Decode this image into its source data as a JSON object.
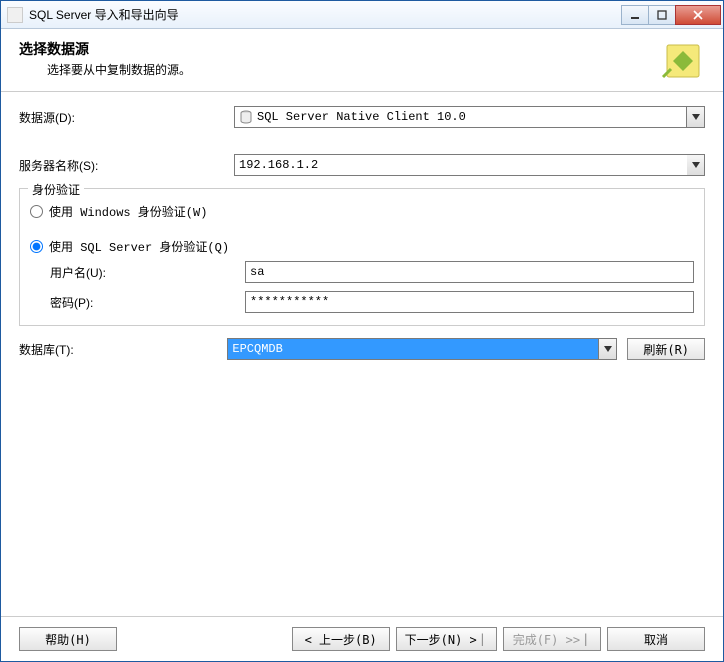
{
  "window": {
    "title": "SQL Server 导入和导出向导"
  },
  "header": {
    "title": "选择数据源",
    "description": "选择要从中复制数据的源。"
  },
  "form": {
    "datasource_label": "数据源(D):",
    "datasource_value": "SQL Server Native Client 10.0",
    "servername_label": "服务器名称(S):",
    "servername_value": "192.168.1.2",
    "auth_legend": "身份验证",
    "auth_windows_label": "使用 Windows 身份验证(W)",
    "auth_sql_label": "使用 SQL Server 身份验证(Q)",
    "auth_mode": "sql",
    "username_label": "用户名(U):",
    "username_value": "sa",
    "password_label": "密码(P):",
    "password_value": "***********",
    "database_label": "数据库(T):",
    "database_value": "EPCQMDB",
    "refresh_label": "刷新(R)"
  },
  "footer": {
    "help": "帮助(H)",
    "back": "< 上一步(B)",
    "next": "下一步(N) >",
    "finish": "完成(F) >>",
    "cancel": "取消"
  }
}
